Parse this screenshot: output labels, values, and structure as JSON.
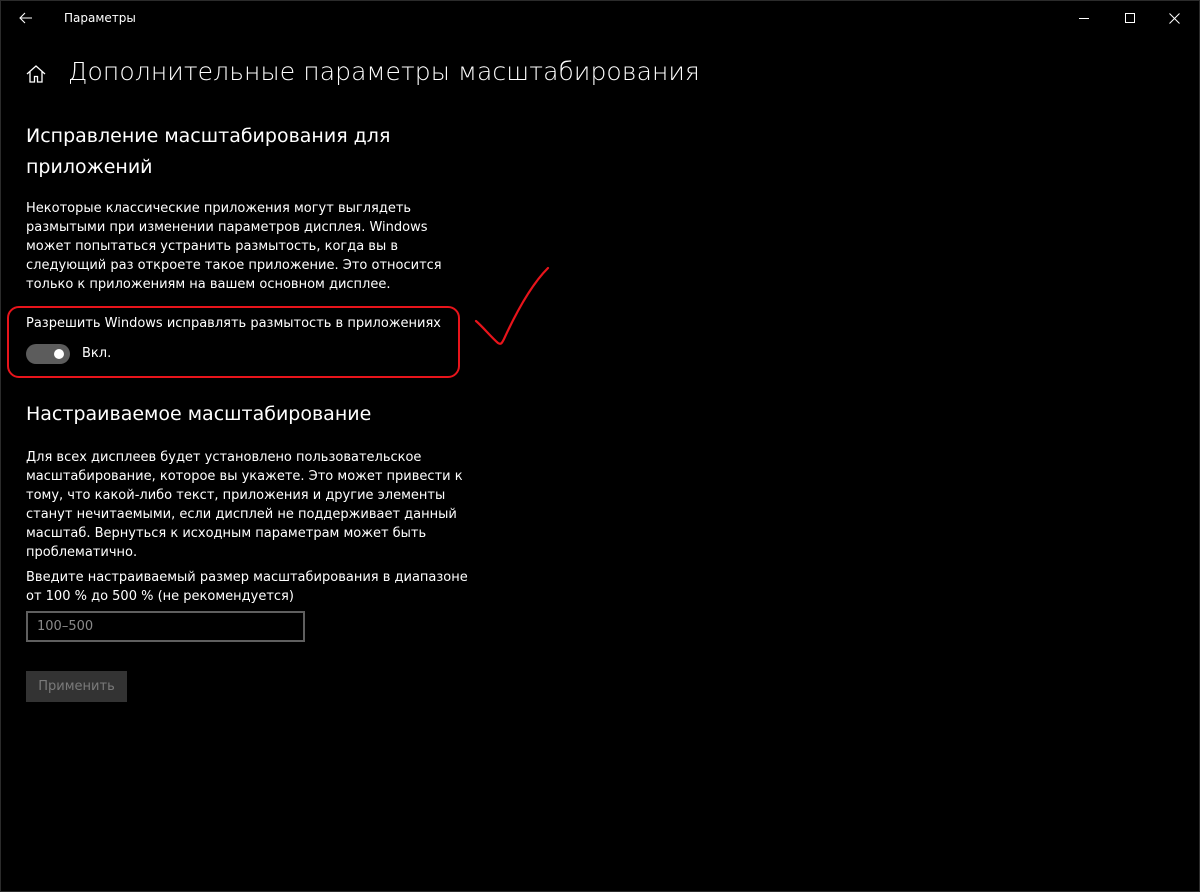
{
  "window": {
    "title": "Параметры"
  },
  "header": {
    "title": "Дополнительные параметры масштабирования"
  },
  "fix_scaling": {
    "heading": "Исправление масштабирования для приложений",
    "description": "Некоторые классические приложения могут выглядеть размытыми при изменении параметров дисплея. Windows может попытаться устранить размытость, когда вы в следующий раз откроете такое приложение. Это относится только к приложениям на вашем основном дисплее.",
    "toggle_label": "Разрешить Windows исправлять размытость в приложениях",
    "toggle_state": "Вкл."
  },
  "custom_scaling": {
    "heading": "Настраиваемое масштабирование",
    "description": "Для всех дисплеев будет установлено пользовательское масштабирование, которое вы укажете. Это может привести к тому, что какой-либо текст, приложения и другие элементы станут нечитаемыми, если дисплей не поддерживает данный масштаб. Вернуться к исходным параметрам может быть проблематично.",
    "range_label": "Введите настраиваемый размер масштабирования в диапазоне от 100 % до 500 % (не рекомендуется)",
    "input_value": "",
    "input_placeholder": "100–500",
    "apply_label": "Применить"
  },
  "colors": {
    "background": "#000000",
    "annotation": "#e8141b",
    "toggle_track": "#5c5c5c",
    "button_disabled": "#333333"
  },
  "icons": {
    "back": "back-arrow-icon",
    "home": "home-icon",
    "minimize": "minimize-icon",
    "maximize": "maximize-icon",
    "close": "close-icon"
  }
}
